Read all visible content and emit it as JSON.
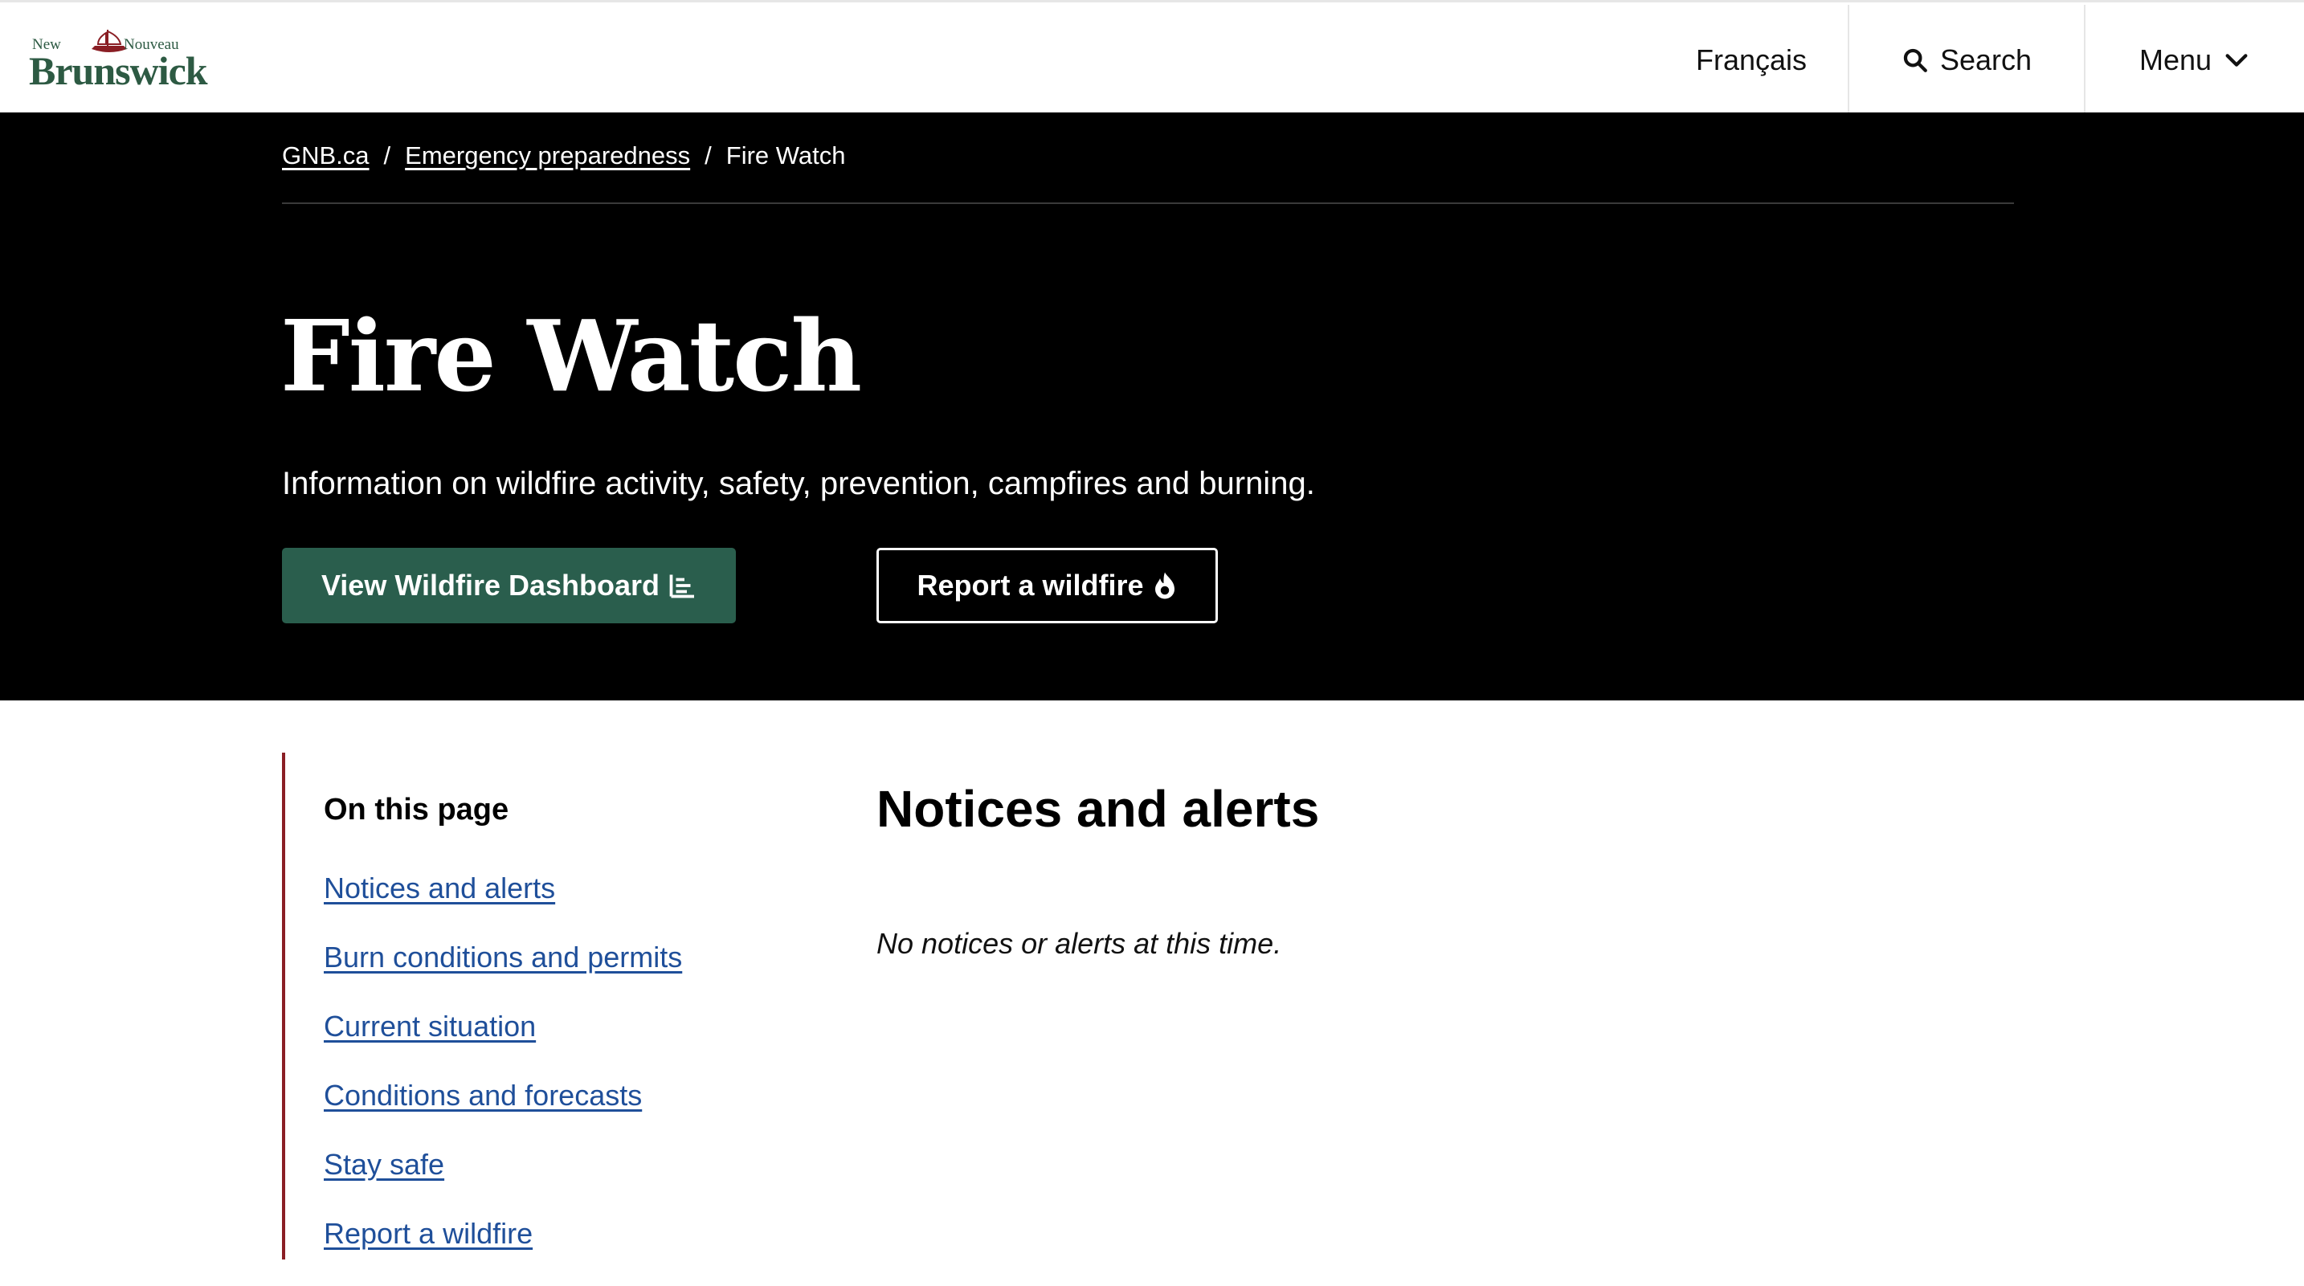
{
  "header": {
    "logo": {
      "new": "New",
      "nouveau": "Nouveau",
      "brand": "Brunswick"
    },
    "language": "Français",
    "search_label": "Search",
    "menu_label": "Menu"
  },
  "breadcrumb": {
    "items": [
      "GNB.ca",
      "Emergency preparedness",
      "Fire Watch"
    ],
    "separator": "/"
  },
  "hero": {
    "title": "Fire Watch",
    "subtitle": "Information on wildfire activity, safety, prevention, campfires and burning.",
    "dashboard_button": "View Wildfire Dashboard",
    "report_button": "Report a wildfire"
  },
  "toc": {
    "title": "On this page",
    "links": [
      "Notices and alerts",
      "Burn conditions and permits",
      "Current situation",
      "Conditions and forecasts",
      "Stay safe",
      "Report a wildfire"
    ]
  },
  "main": {
    "section_title": "Notices and alerts",
    "section_note": "No notices or alerts at this time."
  },
  "colors": {
    "brand_green": "#2a5e4d",
    "toc_accent": "#8a1e24",
    "link_blue": "#1f4f9a",
    "hero_bg": "#000000"
  },
  "icons": {
    "search": "search-icon",
    "menu": "chevron-down-icon",
    "dashboard": "bar-chart-icon",
    "report": "fire-icon"
  }
}
